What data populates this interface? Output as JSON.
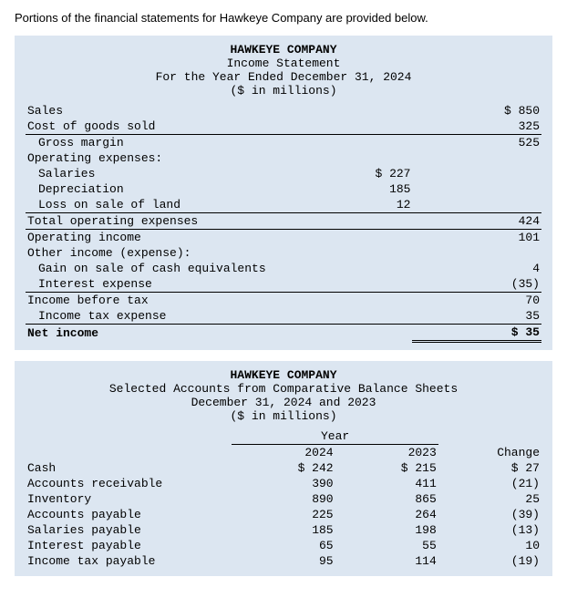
{
  "intro": "Portions of the financial statements for Hawkeye Company are provided below.",
  "income_statement": {
    "company": "HAWKEYE COMPANY",
    "title": "Income Statement",
    "subtitle": "For the Year Ended December 31, 2024",
    "unit": "($ in millions)",
    "rows": [
      {
        "label": "Sales",
        "indent": 0,
        "mid": "",
        "right": "$ 850",
        "border_top": false,
        "bold": false
      },
      {
        "label": "Cost of goods sold",
        "indent": 0,
        "mid": "",
        "right": "325",
        "border_top": false,
        "bold": false
      },
      {
        "label": "Gross margin",
        "indent": 2,
        "mid": "",
        "right": "525",
        "border_top": true,
        "bold": false
      },
      {
        "label": "Operating expenses:",
        "indent": 0,
        "mid": "",
        "right": "",
        "border_top": false,
        "bold": false
      },
      {
        "label": "Salaries",
        "indent": 2,
        "mid": "$ 227",
        "right": "",
        "border_top": false,
        "bold": false
      },
      {
        "label": "Depreciation",
        "indent": 2,
        "mid": "185",
        "right": "",
        "border_top": false,
        "bold": false
      },
      {
        "label": "Loss on sale of land",
        "indent": 2,
        "mid": "12",
        "right": "",
        "border_top": false,
        "bold": false
      },
      {
        "label": "Total operating expenses",
        "indent": 0,
        "mid": "",
        "right": "424",
        "border_top": true,
        "bold": false
      },
      {
        "label": "Operating income",
        "indent": 0,
        "mid": "",
        "right": "101",
        "border_top": true,
        "bold": false
      },
      {
        "label": "Other income (expense):",
        "indent": 0,
        "mid": "",
        "right": "",
        "border_top": false,
        "bold": false
      },
      {
        "label": "Gain on sale of cash equivalents",
        "indent": 2,
        "mid": "",
        "right": "4",
        "border_top": false,
        "bold": false
      },
      {
        "label": "Interest expense",
        "indent": 2,
        "mid": "",
        "right": "(35)",
        "border_top": false,
        "bold": false
      },
      {
        "label": "Income before tax",
        "indent": 0,
        "mid": "",
        "right": "70",
        "border_top": true,
        "bold": false
      },
      {
        "label": "Income tax expense",
        "indent": 2,
        "mid": "",
        "right": "35",
        "border_top": false,
        "bold": false
      },
      {
        "label": "Net income",
        "indent": 0,
        "mid": "",
        "right": "$ 35",
        "border_top": true,
        "bold": true,
        "double": true
      }
    ]
  },
  "balance_sheet": {
    "company": "HAWKEYE COMPANY",
    "title": "Selected Accounts from Comparative Balance Sheets",
    "subtitle": "December 31, 2024 and 2023",
    "unit": "($ in millions)",
    "year_header": "Year",
    "col_2024": "2024",
    "col_2023": "2023",
    "col_change": "Change",
    "rows": [
      {
        "label": "Cash",
        "v2024": "$ 242",
        "v2023": "$ 215",
        "change": "$ 27"
      },
      {
        "label": "Accounts receivable",
        "v2024": "390",
        "v2023": "411",
        "change": "(21)"
      },
      {
        "label": "Inventory",
        "v2024": "890",
        "v2023": "865",
        "change": "25"
      },
      {
        "label": "Accounts payable",
        "v2024": "225",
        "v2023": "264",
        "change": "(39)"
      },
      {
        "label": "Salaries payable",
        "v2024": "185",
        "v2023": "198",
        "change": "(13)"
      },
      {
        "label": "Interest payable",
        "v2024": "65",
        "v2023": "55",
        "change": "10"
      },
      {
        "label": "Income tax payable",
        "v2024": "95",
        "v2023": "114",
        "change": "(19)"
      }
    ]
  }
}
